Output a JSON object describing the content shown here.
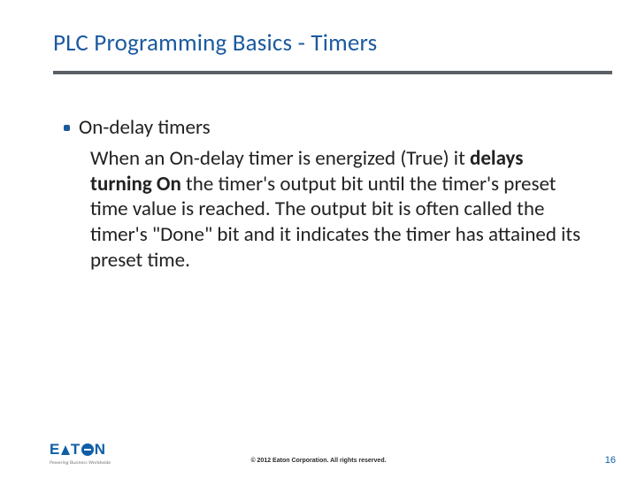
{
  "title": "PLC Programming Basics - Timers",
  "bullet": "On-delay timers",
  "para_1": "When an On-delay timer is energized (True) it ",
  "para_bold": "delays turning On",
  "para_2": " the timer's output bit until the timer's preset time value is reached.  The output bit is often called the timer's \"Done\" bit and it indicates the timer has attained its preset time.",
  "logo": {
    "pre": "E",
    "mid": "T",
    "post": "N",
    "tagline": "Powering Business Worldwide"
  },
  "copyright": "© 2012 Eaton Corporation. All rights reserved.",
  "page": "16"
}
